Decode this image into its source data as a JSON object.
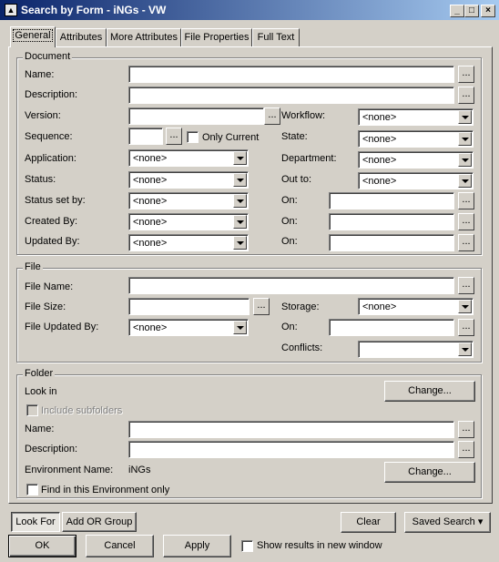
{
  "window": {
    "title": "Search by Form - iNGs - VW",
    "icon": "app-icon"
  },
  "tabs": [
    {
      "label": "General",
      "active": true
    },
    {
      "label": "Attributes"
    },
    {
      "label": "More Attributes"
    },
    {
      "label": "File Properties"
    },
    {
      "label": "Full Text"
    }
  ],
  "document": {
    "legend": "Document",
    "name_label": "Name:",
    "description_label": "Description:",
    "version_label": "Version:",
    "sequence_label": "Sequence:",
    "only_current_label": "Only Current",
    "application_label": "Application:",
    "application_value": "<none>",
    "status_label": "Status:",
    "status_value": "<none>",
    "status_set_by_label": "Status set by:",
    "status_set_by_value": "<none>",
    "created_by_label": "Created By:",
    "created_by_value": "<none>",
    "updated_by_label": "Updated By:",
    "updated_by_value": "<none>",
    "workflow_label": "Workflow:",
    "workflow_value": "<none>",
    "state_label": "State:",
    "state_value": "<none>",
    "department_label": "Department:",
    "department_value": "<none>",
    "out_to_label": "Out to:",
    "out_to_value": "<none>",
    "on_label": "On:"
  },
  "file": {
    "legend": "File",
    "file_name_label": "File Name:",
    "file_size_label": "File Size:",
    "file_updated_by_label": "File Updated By:",
    "file_updated_by_value": "<none>",
    "storage_label": "Storage:",
    "storage_value": "<none>",
    "on_label": "On:",
    "conflicts_label": "Conflicts:",
    "conflicts_value": ""
  },
  "folder": {
    "legend": "Folder",
    "look_in_label": "Look in",
    "change_label": "Change...",
    "include_subfolders_label": "Include subfolders",
    "name_label": "Name:",
    "description_label": "Description:",
    "environment_name_label": "Environment Name:",
    "environment_name_value": "iNGs",
    "find_in_env_label": "Find in this Environment only"
  },
  "dots": "...",
  "bottom": {
    "look_for": "Look For",
    "add_or_group": "Add OR Group",
    "clear": "Clear",
    "saved_search": "Saved Search",
    "ok": "OK",
    "cancel": "Cancel",
    "apply": "Apply",
    "show_results": "Show results in new window"
  }
}
